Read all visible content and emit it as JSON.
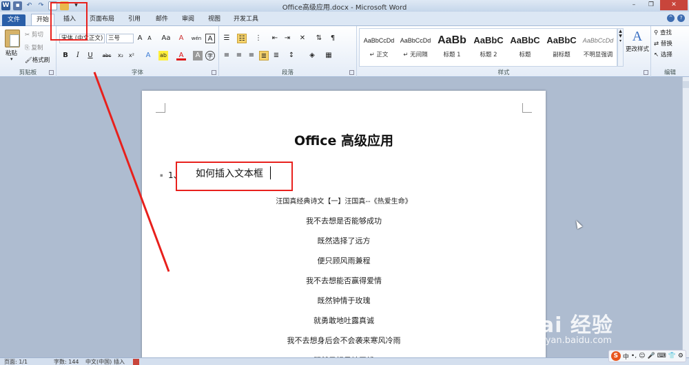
{
  "titlebar": {
    "title": "Office高级应用.docx - Microsoft Word",
    "quick_access": [
      "W",
      "",
      "↶",
      "",
      ""
    ]
  },
  "tabs": {
    "file": "文件",
    "home": "开始",
    "insert": "插入",
    "page_layout": "页面布局",
    "references": "引用",
    "mailings": "邮件",
    "review": "审阅",
    "view": "视图",
    "developer": "开发工具"
  },
  "clipboard": {
    "paste": "粘贴",
    "cut": "剪切",
    "copy": "复制",
    "format_painter": "格式刷",
    "label": "剪贴板"
  },
  "font": {
    "font_name": "宋体 (中文正文)",
    "font_size": "三号",
    "grow": "A",
    "shrink": "A",
    "change_case": "Aa",
    "clear_format": "A",
    "phonetic": "wén",
    "border_char": "A",
    "bold": "B",
    "italic": "I",
    "underline": "U",
    "strike": "abc",
    "subscript": "x₂",
    "superscript": "x²",
    "text_effect": "A",
    "highlight": "ab",
    "font_color": "A",
    "shading_char": "A",
    "enclose_char": "字",
    "label": "字体"
  },
  "paragraph": {
    "label": "段落"
  },
  "styles": {
    "label": "样式",
    "items": [
      {
        "sample": "AaBbCcDd",
        "name": "↵ 正文"
      },
      {
        "sample": "AaBbCcDd",
        "name": "↵ 无间隔"
      },
      {
        "sample": "AaBb",
        "name": "标题 1"
      },
      {
        "sample": "AaBbC",
        "name": "标题 2"
      },
      {
        "sample": "AaBbC",
        "name": "标题"
      },
      {
        "sample": "AaBbC",
        "name": "副标题"
      },
      {
        "sample": "AaBbCcDd",
        "name": "不明显强调"
      }
    ],
    "change_styles": "更改样式"
  },
  "editing": {
    "find": "查找",
    "replace": "替换",
    "select": "选择",
    "label": "编辑"
  },
  "document": {
    "title": "Office 高级应用",
    "list_number": "1、",
    "heading": "如何插入文本框",
    "poem_lines": [
      "汪国真经典诗文【一】汪国真--《热爱生命》",
      "我不去想是否能够成功",
      "既然选择了远方",
      "便只顾风雨兼程",
      "我不去想能否赢得爱情",
      "既然钟情于玫瑰",
      "就勇敢地吐露真诚",
      "我不去想身后会不会袭来寒风冷雨",
      "既然目标是地平线"
    ]
  },
  "statusbar": {
    "page": "页面: 1/1",
    "words": "字数: 144",
    "language": "中文(中国)",
    "mode": "插入"
  },
  "watermark": {
    "brand": "Bai 经验",
    "url": "jingyan.baidu.com"
  },
  "ime": {
    "logo": "S",
    "lang": "中"
  },
  "colors": {
    "annotation": "#e8201c",
    "file_tab": "#2a5fa8"
  }
}
